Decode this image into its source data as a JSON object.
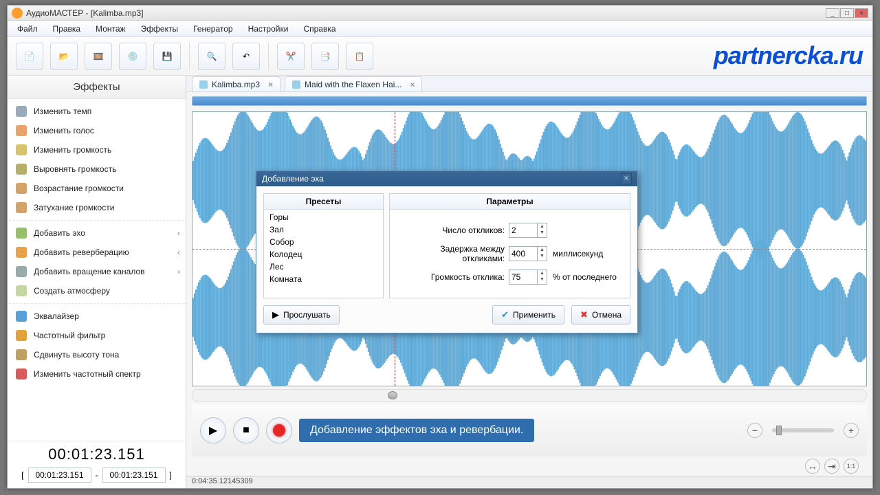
{
  "title": "АудиоМАСТЕР - [Kalimba.mp3]",
  "brand": "partnercka.ru",
  "menus": [
    "Файл",
    "Правка",
    "Монтаж",
    "Эффекты",
    "Генератор",
    "Настройки",
    "Справка"
  ],
  "sidebar": {
    "title": "Эффекты",
    "groups": [
      [
        "Изменить темп",
        "Изменить голос",
        "Изменить громкость",
        "Выровнять громкость",
        "Возрастание громкости",
        "Затухание громкости"
      ],
      [
        "Добавить эхо",
        "Добавить реверберацию",
        "Добавить вращение каналов",
        "Создать атмосферу"
      ],
      [
        "Эквалайзер",
        "Частотный фильтр",
        "Сдвинуть высоту тона",
        "Изменить частотный спектр"
      ]
    ]
  },
  "tabs": [
    {
      "label": "Kalimba.mp3"
    },
    {
      "label": "Maid with the Flaxen Hai..."
    }
  ],
  "time": {
    "current": "00:01:23.151",
    "sel_start": "00:01:23.151",
    "sel_end": "00:01:23.151",
    "sep": "-"
  },
  "transport_tooltip": "Добавление эффектов эха и ревербации.",
  "status": "0:04:35 12145309",
  "modal": {
    "title": "Добавление эха",
    "presets_header": "Пресеты",
    "params_header": "Параметры",
    "presets": [
      "Горы",
      "Зал",
      "Собор",
      "Колодец",
      "Лес",
      "Комната"
    ],
    "rows": {
      "n_echo_label": "Число откликов:",
      "n_echo": "2",
      "delay_label": "Задержка между откликами:",
      "delay": "400",
      "delay_unit": "миллисекунд",
      "vol_label": "Громкость отклика:",
      "vol": "75",
      "vol_unit": "% от последнего"
    },
    "buttons": {
      "preview": "Прослушать",
      "apply": "Применить",
      "cancel": "Отмена"
    }
  }
}
